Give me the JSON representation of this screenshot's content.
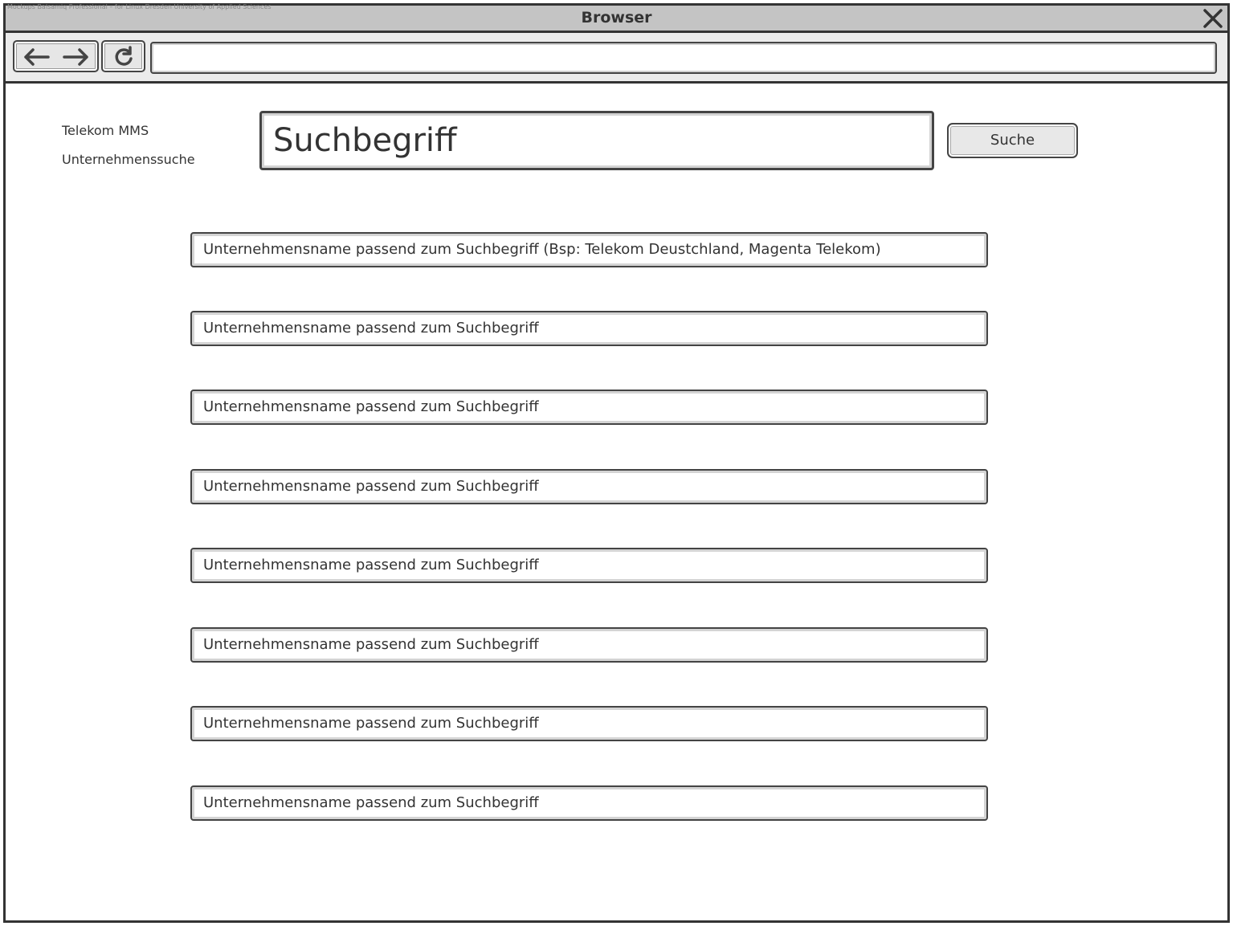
{
  "window": {
    "title": "Browser",
    "watermark": "Mockups Balsamiq Professional – for Linux Dresden University of Applied Sciences"
  },
  "toolbar": {
    "url": ""
  },
  "header": {
    "brand_line1": "Telekom MMS",
    "brand_line2": "Unternehmenssuche"
  },
  "search": {
    "placeholder": "Suchbegriff",
    "button_label": "Suche"
  },
  "results": [
    "Unternehmensname passend zum Suchbegriff (Bsp: Telekom Deustchland, Magenta Telekom)",
    "Unternehmensname passend zum Suchbegriff",
    "Unternehmensname passend zum Suchbegriff",
    "Unternehmensname passend zum Suchbegriff",
    "Unternehmensname passend zum Suchbegriff",
    "Unternehmensname passend zum Suchbegriff",
    "Unternehmensname passend zum Suchbegriff",
    "Unternehmensname passend zum Suchbegriff"
  ],
  "icons": {
    "close": "close-icon",
    "back": "back-arrow-icon",
    "forward": "forward-arrow-icon",
    "reload": "reload-icon"
  }
}
